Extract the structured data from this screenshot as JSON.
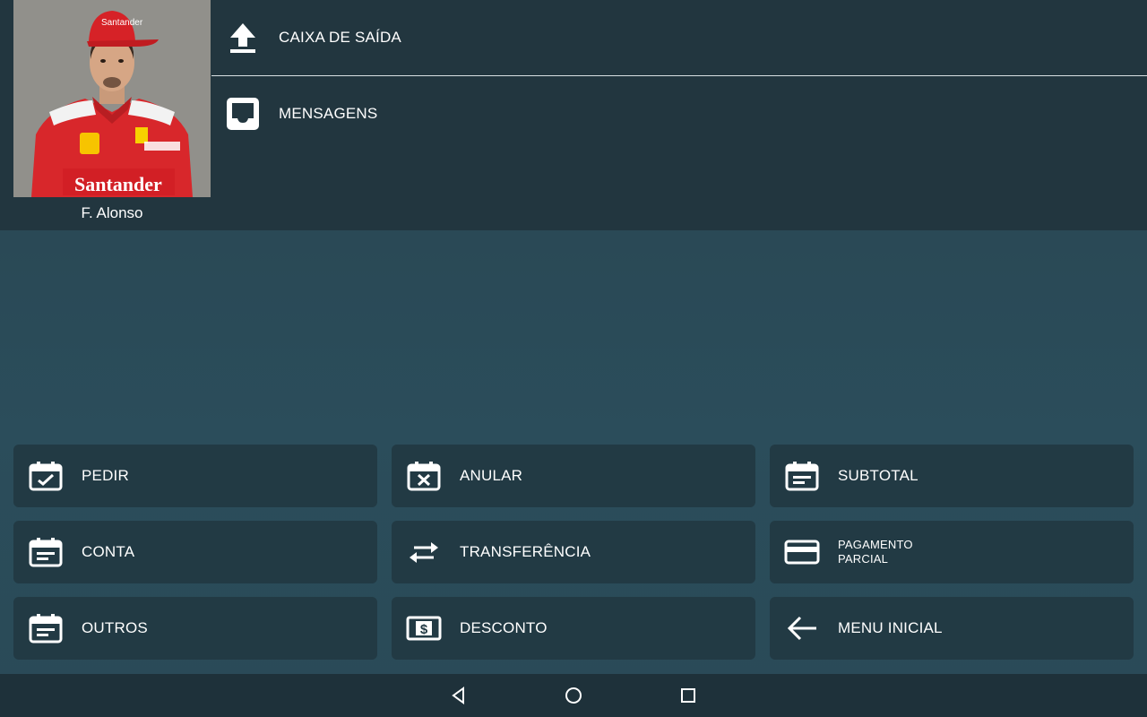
{
  "user": {
    "name": "F. Alonso"
  },
  "menu": [
    {
      "label": "CAIXA DE SAÍDA",
      "icon": "upload-icon"
    },
    {
      "label": "MENSAGENS",
      "icon": "inbox-icon"
    }
  ],
  "actions": [
    {
      "label": "PEDIR",
      "icon": "calendar-check-icon"
    },
    {
      "label": "ANULAR",
      "icon": "calendar-x-icon"
    },
    {
      "label": "SUBTOTAL",
      "icon": "calendar-note-icon"
    },
    {
      "label": "CONTA",
      "icon": "calendar-note-icon"
    },
    {
      "label": "TRANSFERÊNCIA",
      "icon": "swap-arrows-icon"
    },
    {
      "label": "PAGAMENTO\nPARCIAL",
      "icon": "credit-card-icon"
    },
    {
      "label": "OUTROS",
      "icon": "calendar-note-icon"
    },
    {
      "label": "DESCONTO",
      "icon": "money-icon"
    },
    {
      "label": "MENU INICIAL",
      "icon": "arrow-left-icon"
    }
  ],
  "navbar": {
    "items": [
      "back-icon",
      "home-icon",
      "recents-icon"
    ]
  },
  "colors": {
    "panel": "#22363f",
    "button": "#223a44",
    "background": "#28444f",
    "navbar": "#1e313a"
  }
}
